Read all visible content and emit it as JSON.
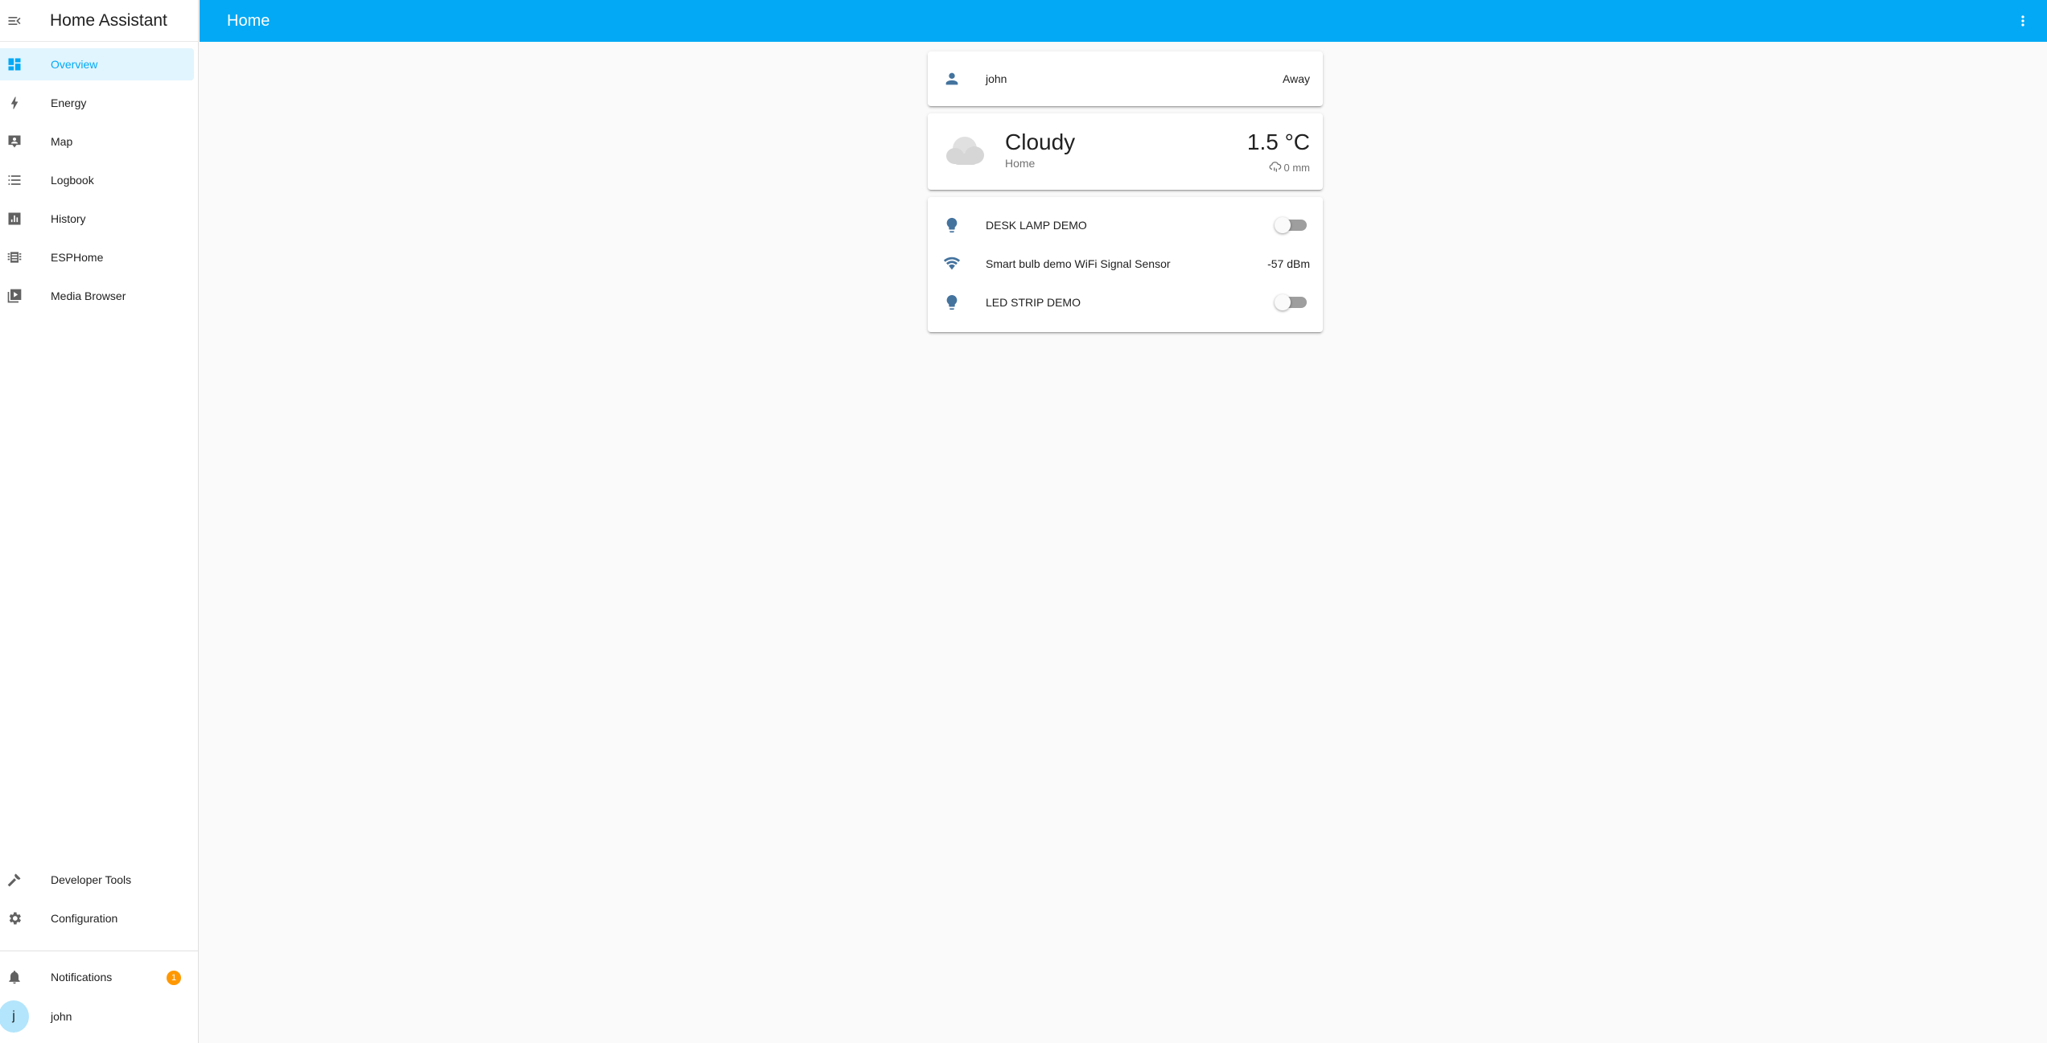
{
  "app": {
    "title": "Home Assistant"
  },
  "header": {
    "title": "Home"
  },
  "sidebar": {
    "items": [
      {
        "label": "Overview",
        "icon": "dashboard-icon",
        "active": true
      },
      {
        "label": "Energy",
        "icon": "lightning-icon"
      },
      {
        "label": "Map",
        "icon": "map-account-icon"
      },
      {
        "label": "Logbook",
        "icon": "list-icon"
      },
      {
        "label": "History",
        "icon": "chart-box-icon"
      },
      {
        "label": "ESPHome",
        "icon": "chip-icon"
      },
      {
        "label": "Media Browser",
        "icon": "play-box-multiple-icon"
      }
    ],
    "bottom": [
      {
        "label": "Developer Tools",
        "icon": "hammer-icon"
      },
      {
        "label": "Configuration",
        "icon": "gear-icon"
      }
    ],
    "notifications": {
      "label": "Notifications",
      "count": "1"
    },
    "user": {
      "label": "john",
      "initial": "j"
    }
  },
  "cards": {
    "person": {
      "name": "john",
      "state": "Away"
    },
    "weather": {
      "condition": "Cloudy",
      "location": "Home",
      "temperature": "1.5 °C",
      "precipitation": "0 mm"
    },
    "entities": [
      {
        "name": "DESK LAMP DEMO",
        "icon": "lightbulb-icon",
        "type": "toggle",
        "on": false
      },
      {
        "name": "Smart bulb demo WiFi Signal Sensor",
        "icon": "wifi-icon",
        "type": "sensor",
        "state": "-57 dBm"
      },
      {
        "name": "LED STRIP DEMO",
        "icon": "lightbulb-icon",
        "type": "toggle",
        "on": false
      }
    ]
  },
  "colors": {
    "primary": "#03a9f4",
    "active_bg": "#e1f5fe",
    "badge": "#ff9800",
    "icon": "#44739e",
    "sidebar_icon": "#616161"
  }
}
